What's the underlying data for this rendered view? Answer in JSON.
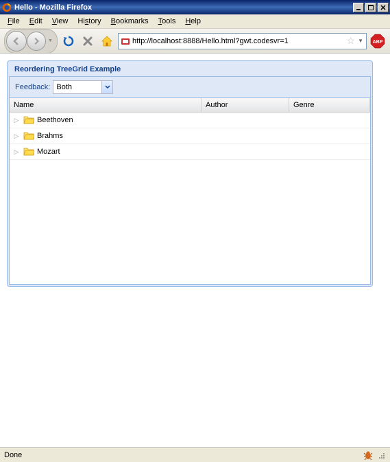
{
  "window": {
    "title": "Hello - Mozilla Firefox"
  },
  "menubar": {
    "items": [
      {
        "label": "File",
        "key": "F"
      },
      {
        "label": "Edit",
        "key": "E"
      },
      {
        "label": "View",
        "key": "V"
      },
      {
        "label": "History",
        "key": "s"
      },
      {
        "label": "Bookmarks",
        "key": "B"
      },
      {
        "label": "Tools",
        "key": "T"
      },
      {
        "label": "Help",
        "key": "H"
      }
    ]
  },
  "toolbar": {
    "url": "http://localhost:8888/Hello.html?gwt.codesvr=1"
  },
  "panel": {
    "title": "Reordering TreeGrid Example",
    "feedback_label": "Feedback:",
    "feedback_value": "Both",
    "columns": {
      "name": "Name",
      "author": "Author",
      "genre": "Genre"
    },
    "rows": [
      {
        "label": "Beethoven"
      },
      {
        "label": "Brahms"
      },
      {
        "label": "Mozart"
      }
    ]
  },
  "statusbar": {
    "text": "Done"
  }
}
